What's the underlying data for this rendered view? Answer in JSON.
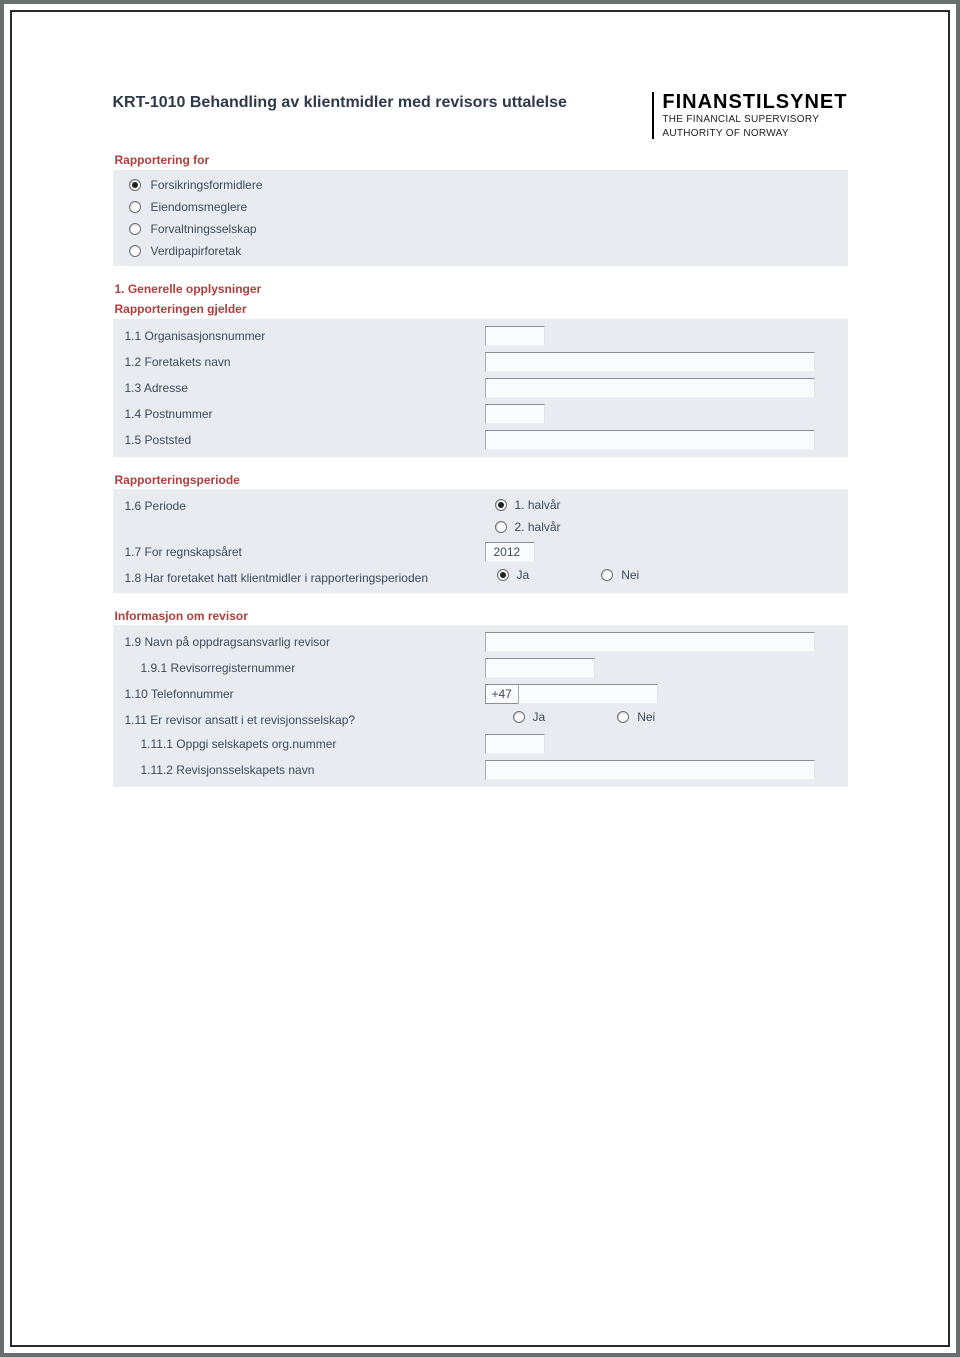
{
  "title": "KRT-1010 Behandling av klientmidler med revisors uttalelse",
  "logo": {
    "main": "FINANSTILSYNET",
    "line1": "THE FINANCIAL SUPERVISORY",
    "line2": "AUTHORITY OF NORWAY"
  },
  "rapportering_for": {
    "heading": "Rapportering for",
    "options": [
      {
        "label": "Forsikringsformidlere",
        "selected": true
      },
      {
        "label": "Eiendomsmeglere",
        "selected": false
      },
      {
        "label": "Forvaltningsselskap",
        "selected": false
      },
      {
        "label": "Verdipapirforetak",
        "selected": false
      }
    ]
  },
  "section1": {
    "heading": "1. Generelle opplysninger",
    "sub_a": {
      "heading": "Rapporteringen gjelder",
      "rows": {
        "r1": "1.1 Organisasjonsnummer",
        "r2": "1.2 Foretakets navn",
        "r3": "1.3 Adresse",
        "r4": "1.4 Postnummer",
        "r5": "1.5 Poststed"
      },
      "values": {
        "r1": "",
        "r2": "",
        "r3": "",
        "r4": "",
        "r5": ""
      }
    },
    "sub_b": {
      "heading": "Rapporteringsperiode",
      "r6_label": "1.6 Periode",
      "r6_opts": {
        "a": "1. halvår",
        "b": "2. halvår"
      },
      "r6_selected": "a",
      "r7_label": "1.7 For regnskapsåret",
      "r7_value": "2012",
      "r8_label": "1.8 Har foretaket hatt klientmidler i rapporteringsperioden",
      "r8_opts": {
        "ja": "Ja",
        "nei": "Nei"
      },
      "r8_selected": "ja"
    },
    "sub_c": {
      "heading": "Informasjon om revisor",
      "r9_label": "1.9 Navn på oppdragsansvarlig revisor",
      "r9_value": "",
      "r91_label": "1.9.1 Revisorregisternummer",
      "r91_value": "",
      "r10_label": "1.10 Telefonnummer",
      "r10_prefix": "+47",
      "r10_value": "",
      "r11_label": "1.11 Er revisor ansatt i et revisjonsselskap?",
      "r11_opts": {
        "ja": "Ja",
        "nei": "Nei"
      },
      "r11_selected": "",
      "r111_label": "1.11.1 Oppgi selskapets org.nummer",
      "r111_value": "",
      "r112_label": "1.11.2 Revisjonsselskapets navn",
      "r112_value": ""
    }
  }
}
